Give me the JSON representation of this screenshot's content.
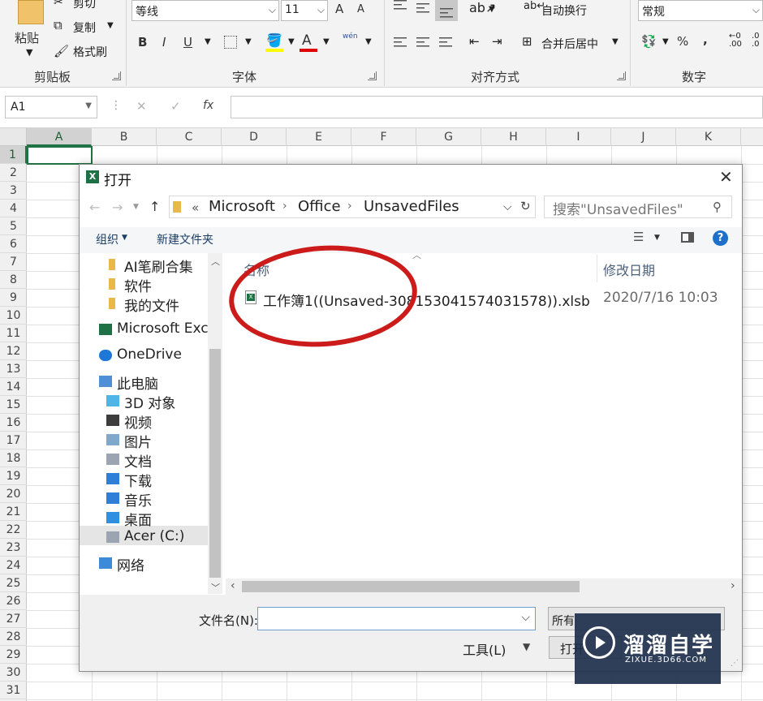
{
  "ribbon": {
    "clipboard": {
      "paste": "粘贴",
      "cut": "剪切",
      "copy": "复制",
      "format_painter": "格式刷",
      "group": "剪贴板"
    },
    "font": {
      "name": "等线",
      "size": "11",
      "grow": "A",
      "shrink": "A",
      "bold": "B",
      "italic": "I",
      "underline": "U",
      "font_color": "A",
      "phonetic": "wén",
      "group": "字体"
    },
    "alignment": {
      "wrap_text": "自动换行",
      "merge_center": "合并后居中",
      "group": "对齐方式"
    },
    "number": {
      "format": "常规",
      "percent": "%",
      "comma": ",",
      "group": "数字"
    }
  },
  "formula_bar": {
    "name_box": "A1",
    "fx": "fx",
    "cancel": "✕",
    "enter": "✓"
  },
  "grid": {
    "columns": [
      "A",
      "B",
      "C",
      "D",
      "E",
      "F",
      "G",
      "H",
      "I",
      "J",
      "K"
    ],
    "rows": [
      "1",
      "2",
      "3",
      "4",
      "5",
      "6",
      "7",
      "8",
      "9",
      "10",
      "11",
      "12",
      "13",
      "14",
      "15",
      "16",
      "17",
      "18",
      "19",
      "20",
      "21",
      "22",
      "23",
      "24",
      "25",
      "26",
      "27",
      "28",
      "29",
      "30",
      "31"
    ]
  },
  "dialog": {
    "title": "打开",
    "close": "✕",
    "breadcrumb": [
      "«",
      "Microsoft",
      "Office",
      "UnsavedFiles"
    ],
    "search_placeholder": "搜索\"UnsavedFiles\"",
    "organize": "组织",
    "new_folder": "新建文件夹",
    "nav_items": [
      "AI笔刷合集",
      "软件",
      "我的文件",
      "Microsoft Exc",
      "OneDrive",
      "此电脑",
      "3D 对象",
      "视频",
      "图片",
      "文档",
      "下载",
      "音乐",
      "桌面",
      "Acer (C:)",
      "网络"
    ],
    "columns": {
      "name": "名称",
      "date": "修改日期"
    },
    "file": {
      "name": "工作簿1((Unsaved-308153041574031578)).xlsb",
      "date": "2020/7/16 10:03"
    },
    "filename_label": "文件名(N):",
    "filename_value": "",
    "filter": "所有",
    "tools": "工具(L)",
    "open": "打开"
  },
  "watermark": {
    "brand": "溜溜自学",
    "url": "ZIXUE.3D66.COM"
  },
  "colors": {
    "excel_green": "#217346",
    "annotation_red": "#cc1b1b",
    "watermark_bg": "#20304c"
  }
}
